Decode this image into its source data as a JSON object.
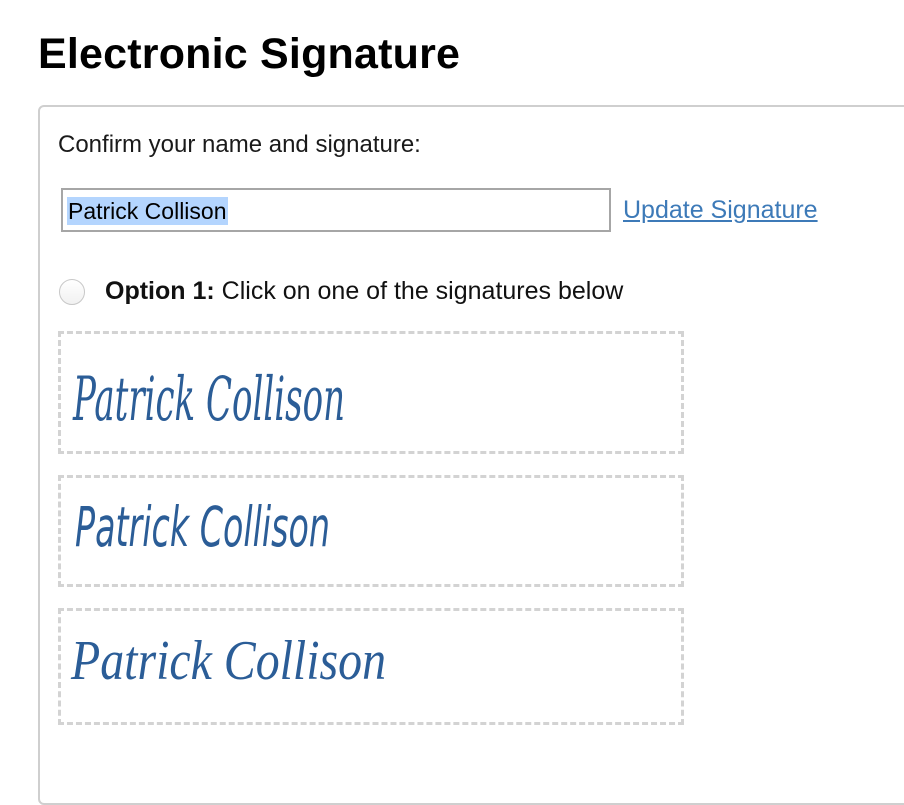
{
  "page": {
    "title": "Electronic Signature"
  },
  "form": {
    "prompt": "Confirm your name and signature:",
    "name_value": "Patrick Collison",
    "update_link": "Update Signature"
  },
  "option1": {
    "label": "Option 1:",
    "description": " Click on one of the signatures below",
    "selected": false
  },
  "signatures": [
    {
      "text": "Patrick Collison",
      "style": "script-1"
    },
    {
      "text": "Patrick Collison",
      "style": "script-2"
    },
    {
      "text": "Patrick Collison",
      "style": "script-3"
    }
  ],
  "colors": {
    "link": "#3d7ab8",
    "signature_ink": "#2b5d97",
    "selection_highlight": "#b4d5fe",
    "dashed_border": "#d3d3d3"
  }
}
